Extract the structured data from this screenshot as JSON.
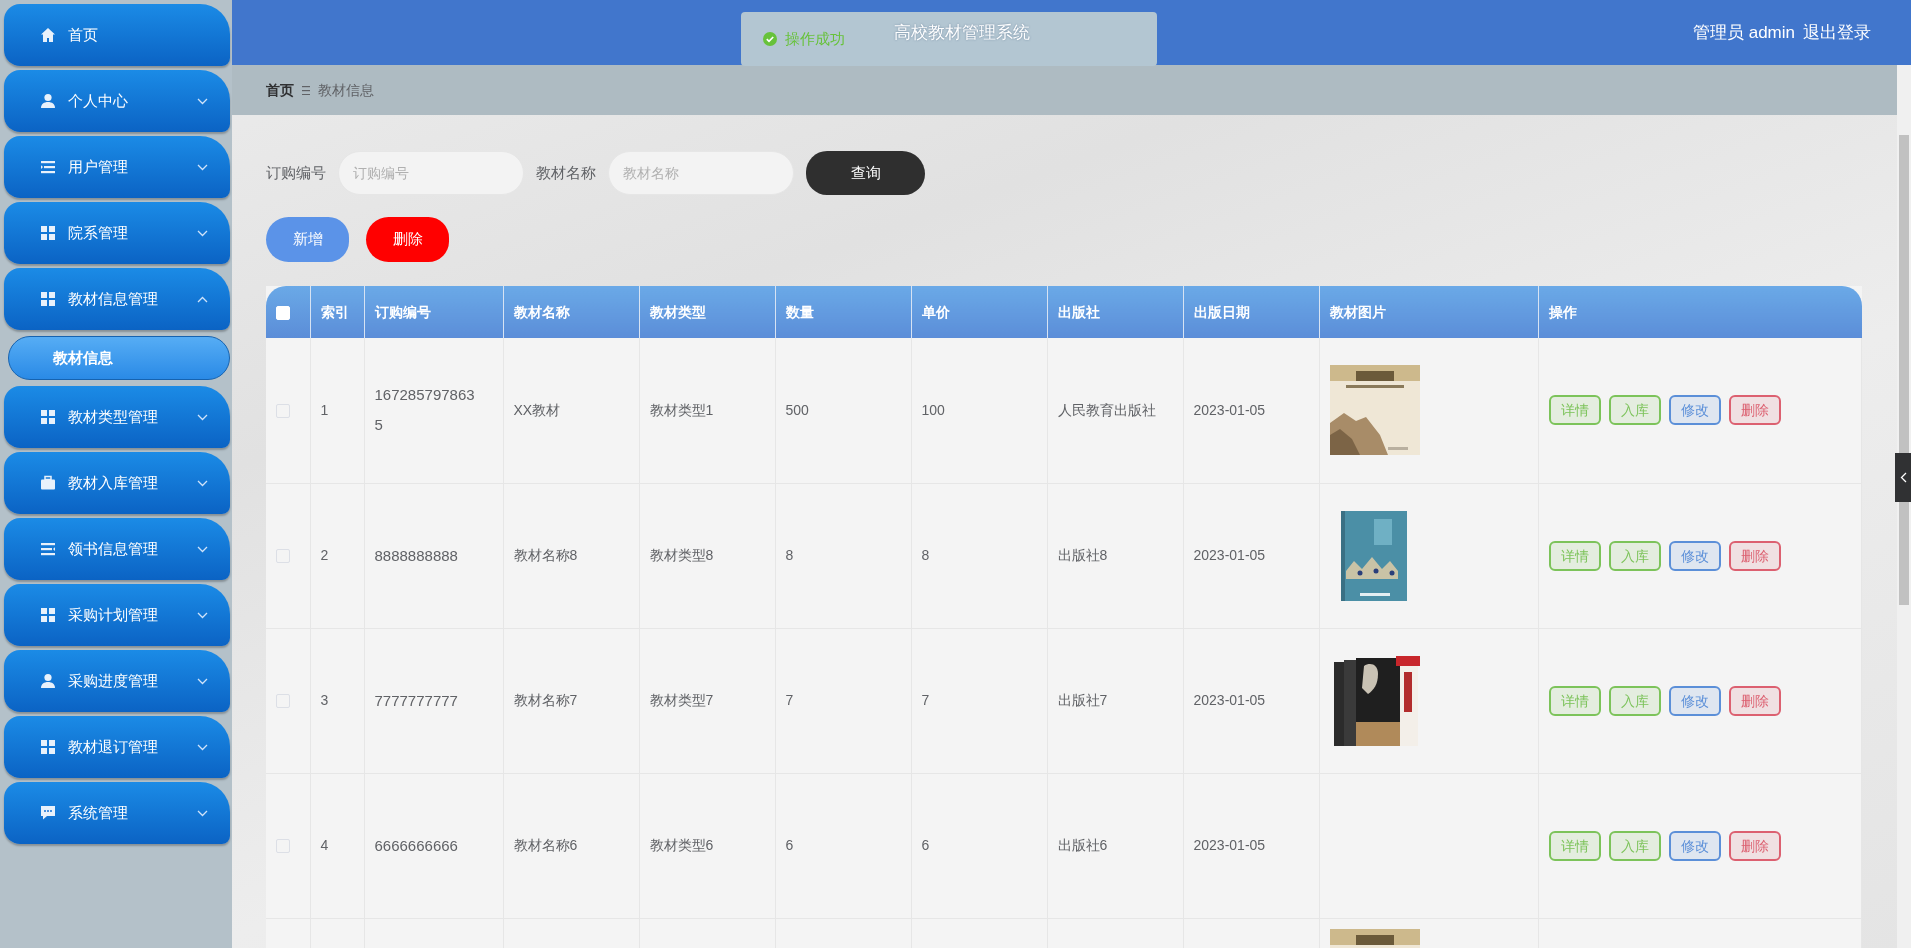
{
  "sidebar": {
    "items": [
      {
        "kind": "link",
        "label": "首页"
      },
      {
        "kind": "group",
        "label": "个人中心",
        "expanded": false
      },
      {
        "kind": "group",
        "label": "用户管理",
        "expanded": false
      },
      {
        "kind": "group",
        "label": "院系管理",
        "expanded": false
      },
      {
        "kind": "group",
        "label": "教材信息管理",
        "expanded": true,
        "children": [
          {
            "label": "教材信息",
            "selected": true
          }
        ]
      },
      {
        "kind": "group",
        "label": "教材类型管理",
        "expanded": false
      },
      {
        "kind": "group",
        "label": "教材入库管理",
        "expanded": false
      },
      {
        "kind": "group",
        "label": "领书信息管理",
        "expanded": false
      },
      {
        "kind": "group",
        "label": "采购计划管理",
        "expanded": false
      },
      {
        "kind": "group",
        "label": "采购进度管理",
        "expanded": false
      },
      {
        "kind": "group",
        "label": "教材退订管理",
        "expanded": false
      },
      {
        "kind": "group",
        "label": "系统管理",
        "expanded": false
      }
    ]
  },
  "header": {
    "title": "高校教材管理系统",
    "user": "管理员 admin",
    "logout": "退出登录"
  },
  "toast": {
    "message": "操作成功"
  },
  "breadcrumb": [
    {
      "label": "首页",
      "link": true
    },
    {
      "label": "教材信息",
      "link": false
    }
  ],
  "search": {
    "fields": [
      {
        "label": "订购编号",
        "placeholder": "订购编号"
      },
      {
        "label": "教材名称",
        "placeholder": "教材名称"
      }
    ],
    "button": "查询"
  },
  "toolbar": [
    {
      "label": "新增",
      "color": "#5b93e8"
    },
    {
      "label": "删除",
      "color": "#ff0000"
    }
  ],
  "table": {
    "select_all": {
      "checked": false
    },
    "columns": [
      "索引",
      "订购编号",
      "教材名称",
      "教材类型",
      "数量",
      "单价",
      "出版社",
      "出版日期",
      "教材图片",
      "操作"
    ],
    "rows": [
      {
        "checked": false,
        "index": "1",
        "order_no": "1672857978635",
        "name": "XX教材",
        "type": "教材类型1",
        "quantity": "500",
        "price": "100",
        "publisher": "人民教育出版社",
        "date": "2023-01-05",
        "picture": true,
        "actions": [
          {
            "label": "详情",
            "color": "#7cc35a"
          },
          {
            "label": "入库",
            "color": "#7cc35a"
          },
          {
            "label": "修改",
            "color": "#5b8fd8"
          },
          {
            "label": "删除",
            "color": "#dc6070"
          }
        ]
      },
      {
        "checked": false,
        "index": "2",
        "order_no": "8888888888",
        "name": "教材名称8",
        "type": "教材类型8",
        "quantity": "8",
        "price": "8",
        "publisher": "出版社8",
        "date": "2023-01-05",
        "picture": true,
        "actions": [
          {
            "label": "详情",
            "color": "#7cc35a"
          },
          {
            "label": "入库",
            "color": "#7cc35a"
          },
          {
            "label": "修改",
            "color": "#5b8fd8"
          },
          {
            "label": "删除",
            "color": "#dc6070"
          }
        ]
      },
      {
        "checked": false,
        "index": "3",
        "order_no": "7777777777",
        "name": "教材名称7",
        "type": "教材类型7",
        "quantity": "7",
        "price": "7",
        "publisher": "出版社7",
        "date": "2023-01-05",
        "picture": true,
        "actions": [
          {
            "label": "详情",
            "color": "#7cc35a"
          },
          {
            "label": "入库",
            "color": "#7cc35a"
          },
          {
            "label": "修改",
            "color": "#5b8fd8"
          },
          {
            "label": "删除",
            "color": "#dc6070"
          }
        ]
      },
      {
        "checked": false,
        "index": "4",
        "order_no": "6666666666",
        "name": "教材名称6",
        "type": "教材类型6",
        "quantity": "6",
        "price": "6",
        "publisher": "出版社6",
        "date": "2023-01-05",
        "picture": false,
        "actions": [
          {
            "label": "详情",
            "color": "#7cc35a"
          },
          {
            "label": "入库",
            "color": "#7cc35a"
          },
          {
            "label": "修改",
            "color": "#5b8fd8"
          },
          {
            "label": "删除",
            "color": "#dc6070"
          }
        ]
      },
      {
        "picture": true
      }
    ]
  }
}
